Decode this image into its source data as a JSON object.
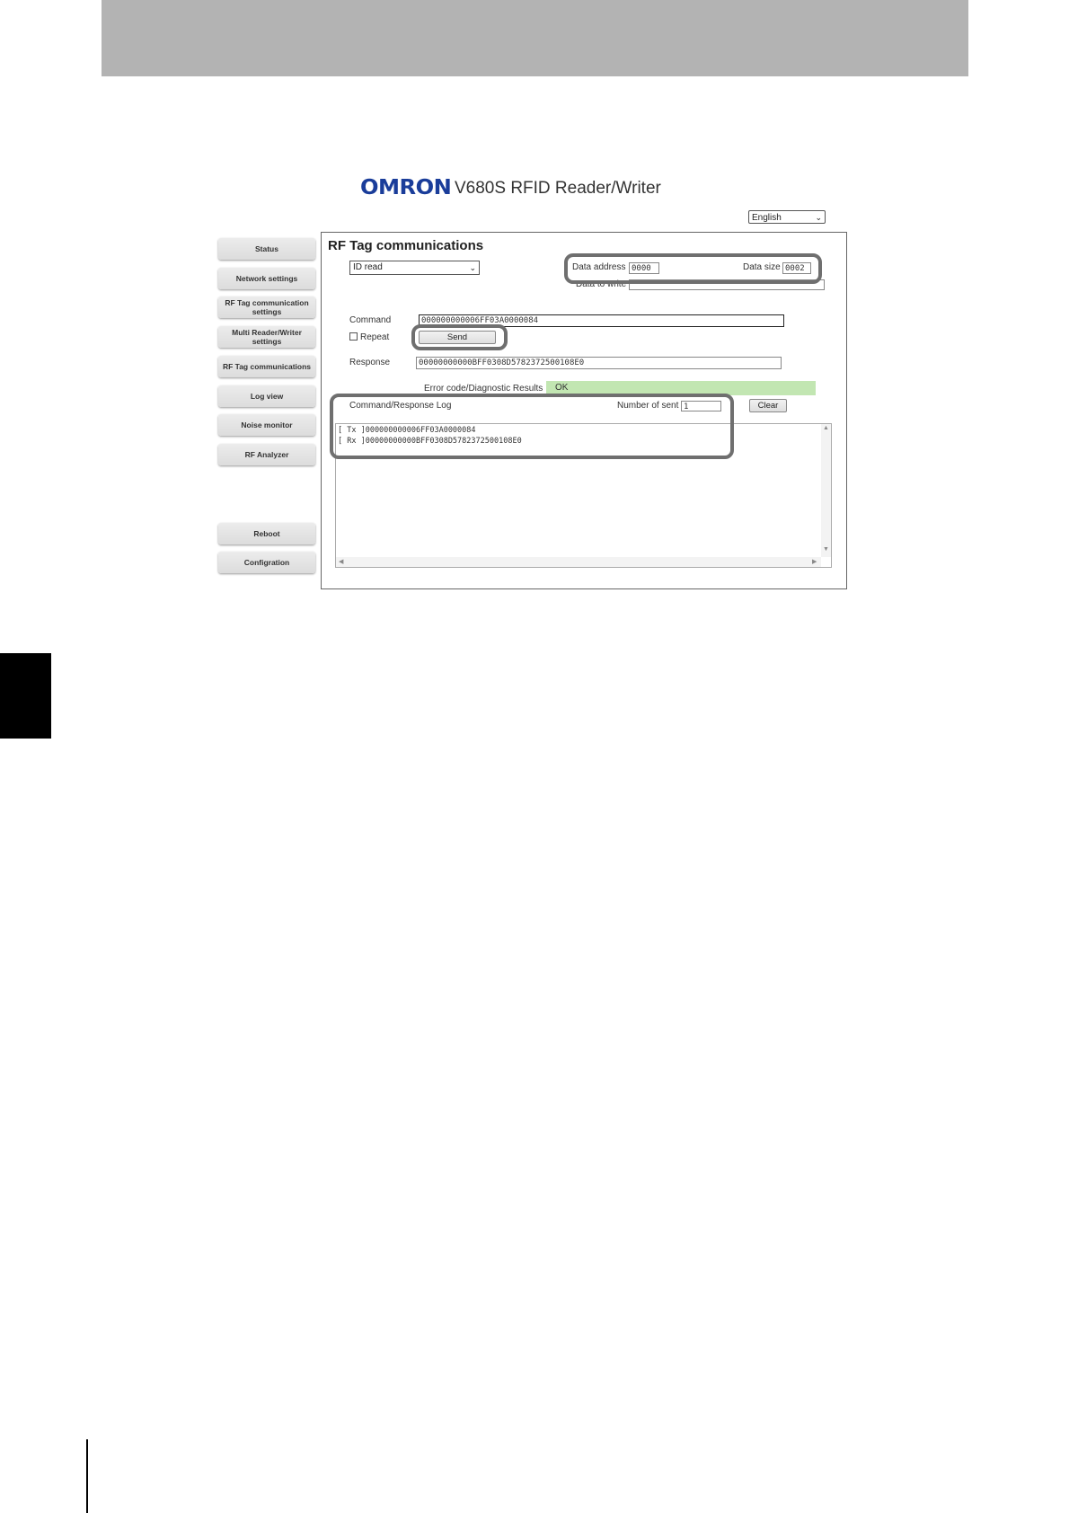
{
  "header": {
    "logo": "OMRON",
    "app_title": "V680S RFID Reader/Writer",
    "language": "English"
  },
  "nav": {
    "status": "Status",
    "network_settings": "Network settings",
    "rf_tag_comm_settings_line1": "RF Tag communication",
    "rf_tag_comm_settings_line2": "settings",
    "multi_rw_line1": "Multi Reader/Writer",
    "multi_rw_line2": "settings",
    "rf_tag_communications": "RF Tag communications",
    "log_view": "Log view",
    "noise_monitor": "Noise monitor",
    "rf_analyzer": "RF Analyzer",
    "reboot": "Reboot",
    "configuration": "Configration"
  },
  "main": {
    "title": "RF Tag communications",
    "command_type": "ID read",
    "data_address_label": "Data address",
    "data_address": "0000",
    "data_size_label": "Data size",
    "data_size": "0002",
    "data_to_write_label": "Data to write",
    "data_to_write": "",
    "command_label": "Command",
    "command": "000000000006FF03A0000084",
    "repeat_label": "Repeat",
    "send_label": "Send",
    "response_label": "Response",
    "response": "00000000000BFF0308D5782372500108E0",
    "error_label": "Error code/Diagnostic Results",
    "error_value": "OK",
    "log_label": "Command/Response Log",
    "number_sent_label": "Number of sent",
    "number_sent": "1",
    "clear_label": "Clear",
    "log_lines": [
      "[ Tx ]000000000006FF03A0000084",
      "[ Rx ]00000000000BFF0308D5782372500108E0"
    ]
  }
}
